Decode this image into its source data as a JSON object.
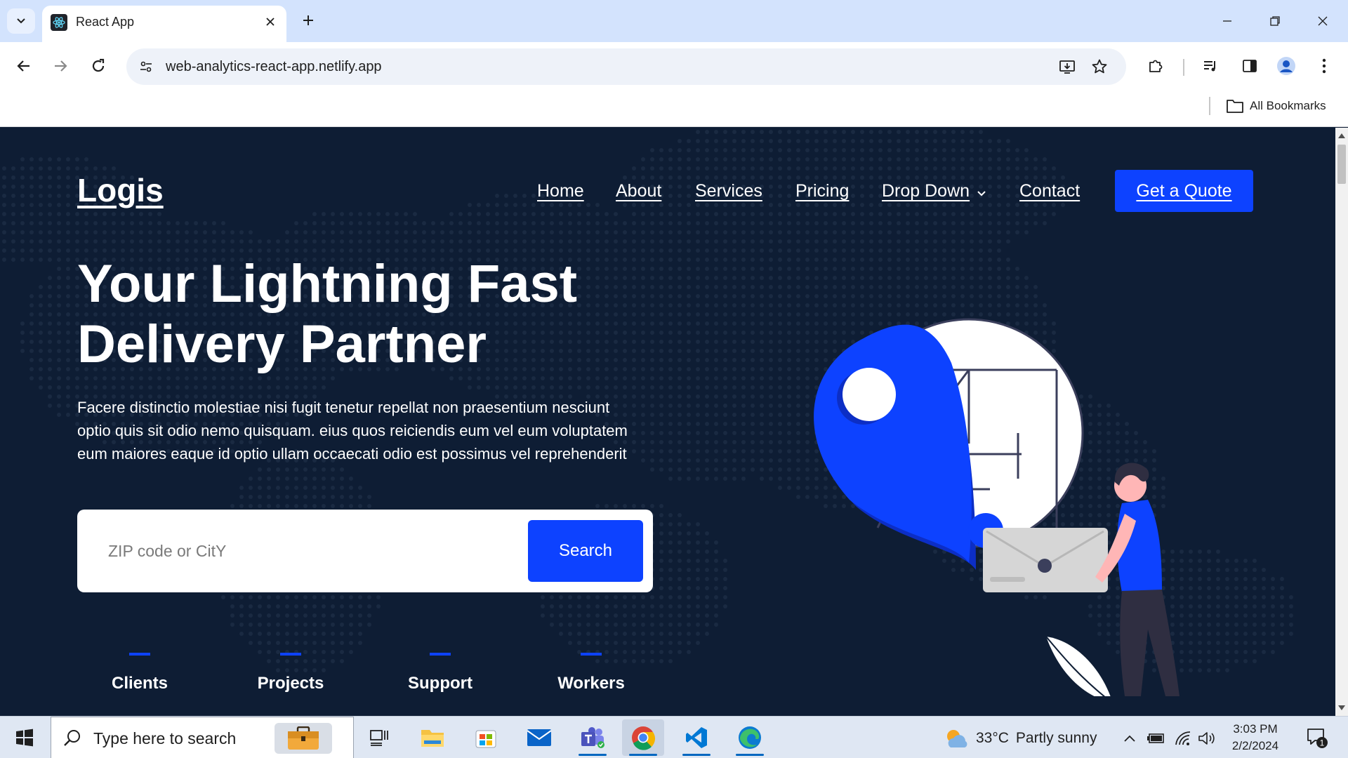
{
  "browser": {
    "tab_title": "React App",
    "url": "web-analytics-react-app.netlify.app",
    "bookmarks_label": "All Bookmarks"
  },
  "site": {
    "logo": "Logis",
    "nav": [
      {
        "label": "Home"
      },
      {
        "label": "About"
      },
      {
        "label": "Services"
      },
      {
        "label": "Pricing"
      },
      {
        "label": "Drop Down"
      },
      {
        "label": "Contact"
      }
    ],
    "cta_label": "Get a Quote",
    "hero": {
      "title_line1": "Your Lightning Fast",
      "title_line2": "Delivery Partner",
      "text_line1": "Facere distinctio molestiae nisi fugit tenetur repellat non praesentium nesciunt",
      "text_line2": "optio quis sit odio nemo quisquam. eius quos reiciendis eum vel eum voluptatem",
      "text_line3": "eum maiores eaque id optio ullam occaecati odio est possimus vel reprehenderit"
    },
    "search": {
      "placeholder": "ZIP code or CitY",
      "button_label": "Search"
    },
    "stats": [
      {
        "label": "Clients"
      },
      {
        "label": "Projects"
      },
      {
        "label": "Support"
      },
      {
        "label": "Workers"
      }
    ],
    "colors": {
      "background": "#0e1d34",
      "accent": "#0d42ff"
    }
  },
  "taskbar": {
    "search_placeholder": "Type here to search",
    "weather_temp": "33°C",
    "weather_desc": "Partly sunny",
    "time": "3:03 PM",
    "date": "2/2/2024",
    "notification_count": "1"
  }
}
